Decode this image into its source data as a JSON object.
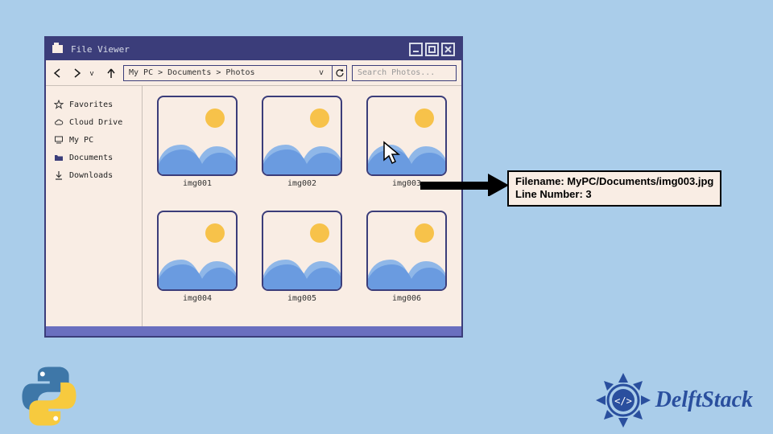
{
  "window": {
    "title": "File Viewer",
    "breadcrumb": "My PC > Documents > Photos",
    "search_placeholder": "Search Photos..."
  },
  "sidebar": {
    "items": [
      {
        "label": "Favorites"
      },
      {
        "label": "Cloud Drive"
      },
      {
        "label": "My PC"
      },
      {
        "label": "Documents"
      },
      {
        "label": "Downloads"
      }
    ]
  },
  "thumbnails": [
    {
      "label": "img001"
    },
    {
      "label": "img002"
    },
    {
      "label": "img003"
    },
    {
      "label": "img004"
    },
    {
      "label": "img005"
    },
    {
      "label": "img006"
    }
  ],
  "callout": {
    "line1": "Filename: MyPC/Documents/img003.jpg",
    "line2": "Line Number: 3"
  },
  "brand": {
    "name": "DelftStack"
  }
}
